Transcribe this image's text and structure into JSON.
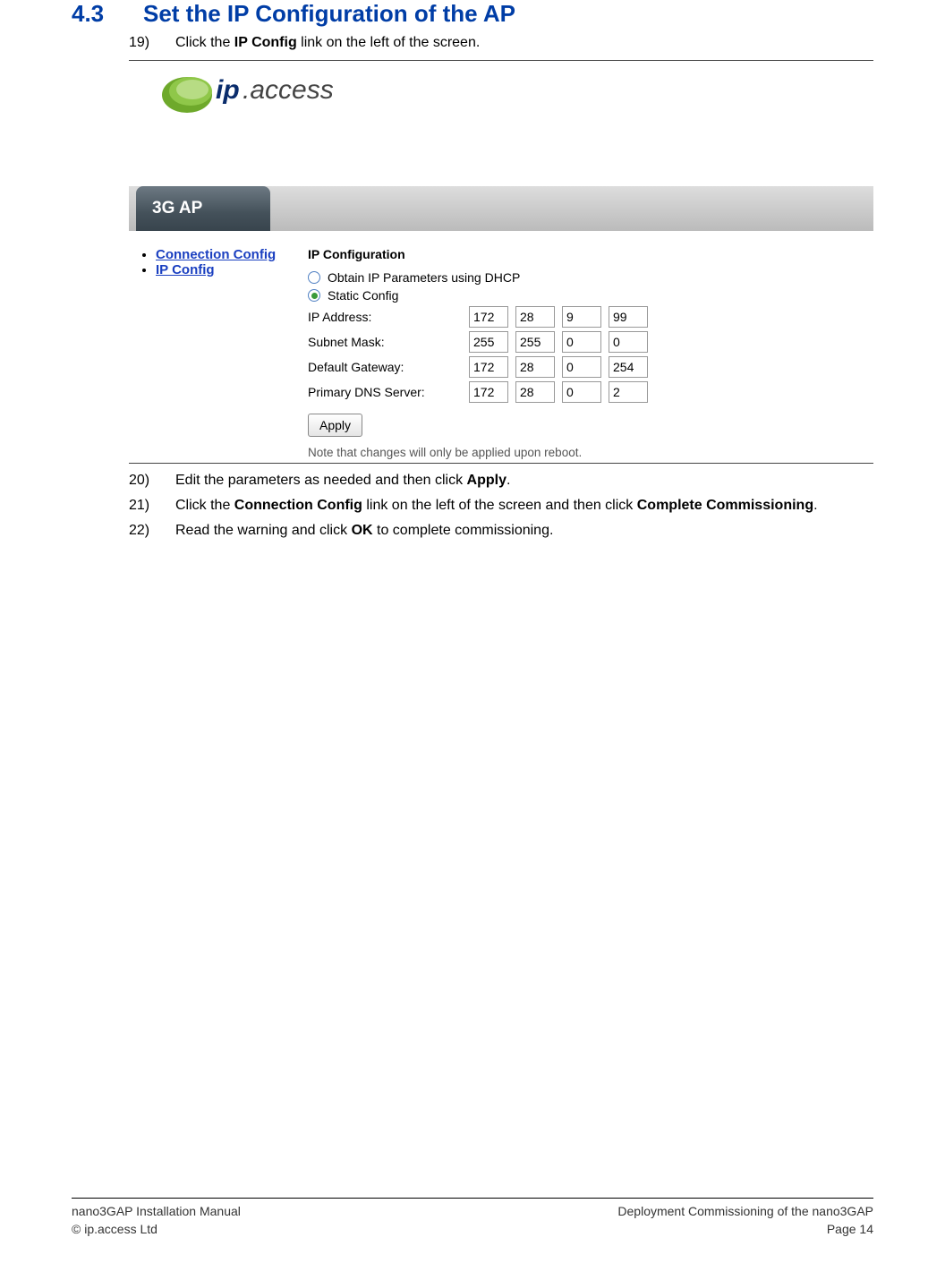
{
  "heading": {
    "number": "4.3",
    "title": "Set the IP Configuration of the AP"
  },
  "steps": {
    "s19": {
      "num": "19)",
      "pre": "Click the ",
      "bold1": "IP Config",
      "post": " link on the left of the screen."
    },
    "s20": {
      "num": "20)",
      "pre": "Edit the parameters as needed and then click ",
      "bold1": "Apply",
      "post": "."
    },
    "s21": {
      "num": "21)",
      "pre": "Click the ",
      "bold1": "Connection Config",
      "mid": " link on the left of the screen and then click ",
      "bold2": "Complete Commissioning",
      "post": "."
    },
    "s22": {
      "num": "22)",
      "pre": "Read the warning and click ",
      "bold1": "OK",
      "post": " to complete commissioning."
    }
  },
  "logo_text": {
    "ip": "ip",
    "access": ".access"
  },
  "app_tab": "3G AP",
  "nav": {
    "connection": "Connection Config",
    "ipconfig": "IP Config"
  },
  "form": {
    "legend": "IP Configuration",
    "radio_dhcp": "Obtain IP Parameters using DHCP",
    "radio_static": "Static Config",
    "ipaddr_label": "IP Address:",
    "subnet_label": "Subnet Mask:",
    "gateway_label": "Default Gateway:",
    "dns_label": "Primary DNS Server:",
    "apply": "Apply",
    "note": "Note that changes will only be applied upon reboot.",
    "ipaddr": [
      "172",
      "28",
      "9",
      "99"
    ],
    "subnet": [
      "255",
      "255",
      "0",
      "0"
    ],
    "gateway": [
      "172",
      "28",
      "0",
      "254"
    ],
    "dns": [
      "172",
      "28",
      "0",
      "2"
    ]
  },
  "footer": {
    "left1": "nano3GAP Installation Manual",
    "left2": "© ip.access Ltd",
    "right1": "Deployment Commissioning of the nano3GAP",
    "right2": "Page 14"
  }
}
